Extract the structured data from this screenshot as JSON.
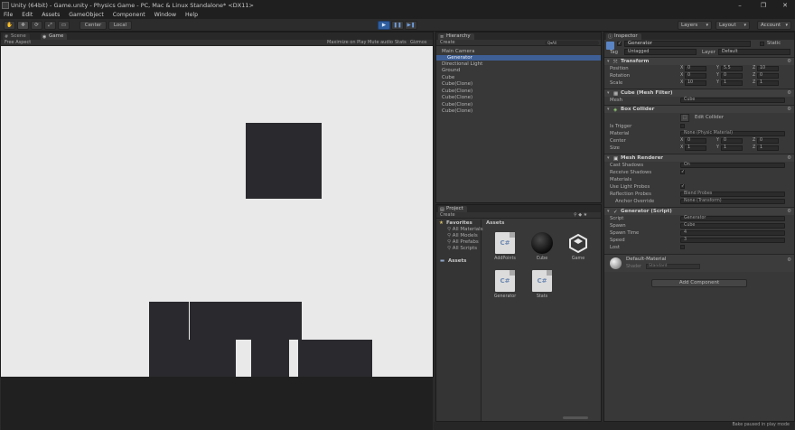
{
  "window": {
    "title": "Unity (64bit) - Game.unity - Physics Game - PC, Mac & Linux Standalone* <DX11>",
    "minimize": "–",
    "maximize": "❐",
    "close": "✕"
  },
  "menu": [
    "File",
    "Edit",
    "Assets",
    "GameObject",
    "Component",
    "Window",
    "Help"
  ],
  "toolbar": {
    "tools": [
      "✋",
      "✥",
      "⟳",
      "⤢",
      "▭"
    ],
    "pivot": "Center",
    "space": "Local",
    "play": "▶",
    "pause": "❚❚",
    "step": "▶❚",
    "layers": "Layers",
    "layout": "Layout",
    "account": "Account"
  },
  "scene_game": {
    "tabs": [
      "Scene",
      "Game"
    ],
    "aspect": "Free Aspect",
    "options": [
      "Maximize on Play",
      "Mute audio",
      "Stats",
      "Gizmos"
    ]
  },
  "hierarchy": {
    "tab": "Hierarchy",
    "create": "Create",
    "search_placeholder": "Q▾All",
    "items": [
      "Main Camera",
      "Generator",
      "Directional Light",
      "Ground",
      "Cube",
      "Cube(Clone)",
      "Cube(Clone)",
      "Cube(Clone)",
      "Cube(Clone)",
      "Cube(Clone)"
    ],
    "selected_index": 1
  },
  "project": {
    "tab": "Project",
    "create": "Create",
    "favorites": {
      "label": "Favorites",
      "items": [
        "All Materials",
        "All Models",
        "All Prefabs",
        "All Scripts"
      ]
    },
    "assets_label": "Assets",
    "assets_header": "Assets",
    "files": [
      {
        "name": "AddPoints",
        "kind": "script",
        "icon": "C#"
      },
      {
        "name": "Cube",
        "kind": "prefab",
        "icon": ""
      },
      {
        "name": "Game",
        "kind": "scene",
        "icon": ""
      },
      {
        "name": "Generator",
        "kind": "script",
        "icon": "C#"
      },
      {
        "name": "Stats",
        "kind": "script",
        "icon": "C#"
      }
    ]
  },
  "inspector": {
    "tab": "Inspector",
    "object_name": "Generator",
    "static": "Static",
    "tag_label": "Tag",
    "tag": "Untagged",
    "layer_label": "Layer",
    "layer": "Default",
    "transform": {
      "title": "Transform",
      "rows": [
        {
          "label": "Position",
          "x": "0",
          "y": "5.5",
          "z": "10"
        },
        {
          "label": "Rotation",
          "x": "0",
          "y": "0",
          "z": "0"
        },
        {
          "label": "Scale",
          "x": "10",
          "y": "1",
          "z": "1"
        }
      ]
    },
    "mesh_filter": {
      "title": "Cube (Mesh Filter)",
      "mesh_label": "Mesh",
      "mesh": "Cube"
    },
    "box_collider": {
      "title": "Box Collider",
      "edit": "Edit Collider",
      "is_trigger": "Is Trigger",
      "material_label": "Material",
      "material": "None (Physic Material)",
      "center_label": "Center",
      "center": {
        "x": "0",
        "y": "0",
        "z": "0"
      },
      "size_label": "Size",
      "size": {
        "x": "1",
        "y": "1",
        "z": "1"
      }
    },
    "mesh_renderer": {
      "title": "Mesh Renderer",
      "cast_shadows_label": "Cast Shadows",
      "cast_shadows": "On",
      "receive_shadows": "Receive Shadows",
      "materials": "Materials",
      "use_light_probes": "Use Light Probes",
      "reflection_probes_label": "Reflection Probes",
      "reflection_probes": "Blend Probes",
      "anchor_override_label": "Anchor Override",
      "anchor_override": "None (Transform)"
    },
    "generator_script": {
      "title": "Generator (Script)",
      "script_label": "Script",
      "script": "Generator",
      "spawn_label": "Spawn",
      "spawn": "Cube",
      "spawn_time_label": "Spawn Time",
      "spawn_time": "4",
      "speed_label": "Speed",
      "speed": "3",
      "lost_label": "Lost"
    },
    "material": {
      "name": "Default-Material",
      "shader_label": "Shader",
      "shader": "Standard"
    },
    "add_component": "Add Component"
  },
  "status": "Bake paused in play mode",
  "colors": {
    "game_bg": "#e9e9ea",
    "block": "#2a2a2e",
    "selection": "#3e5f96",
    "play_active": "#2f5e9e"
  }
}
